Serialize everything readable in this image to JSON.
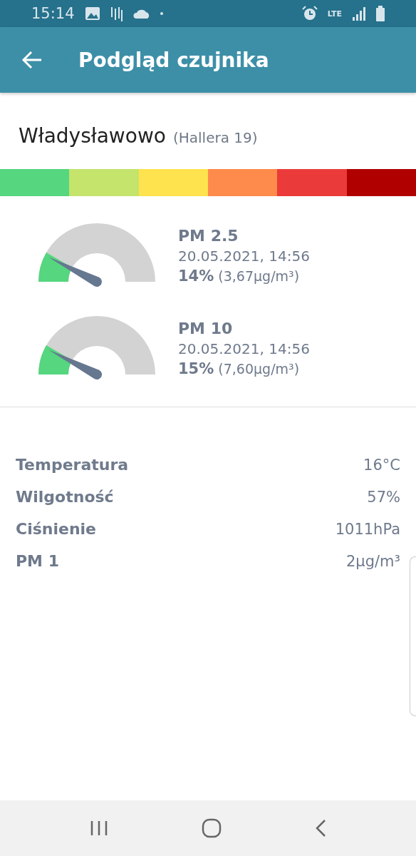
{
  "status_bar": {
    "time": "15:14",
    "network": "LTE"
  },
  "app_bar": {
    "title": "Podgląd czujnika"
  },
  "station": {
    "name": "Władysławowo",
    "address": "(Hallera 19)"
  },
  "scale": [
    {
      "color": "#55d67f"
    },
    {
      "color": "#c4e46c"
    },
    {
      "color": "#fee24e"
    },
    {
      "color": "#fe8a4b"
    },
    {
      "color": "#eb3a3a"
    },
    {
      "color": "#b00000"
    }
  ],
  "gauges": [
    {
      "name": "PM 2.5",
      "date": "20.05.2021, 14:56",
      "percent": "14%",
      "value": "(3,67µg/m³)"
    },
    {
      "name": "PM 10",
      "date": "20.05.2021, 14:56",
      "percent": "15%",
      "value": "(7,60µg/m³)"
    }
  ],
  "readings": [
    {
      "label": "Temperatura",
      "value": "16°C"
    },
    {
      "label": "Wilgotność",
      "value": "57%"
    },
    {
      "label": "Ciśnienie",
      "value": "1011hPa"
    },
    {
      "label": "PM 1",
      "value": "2µg/m³"
    }
  ]
}
